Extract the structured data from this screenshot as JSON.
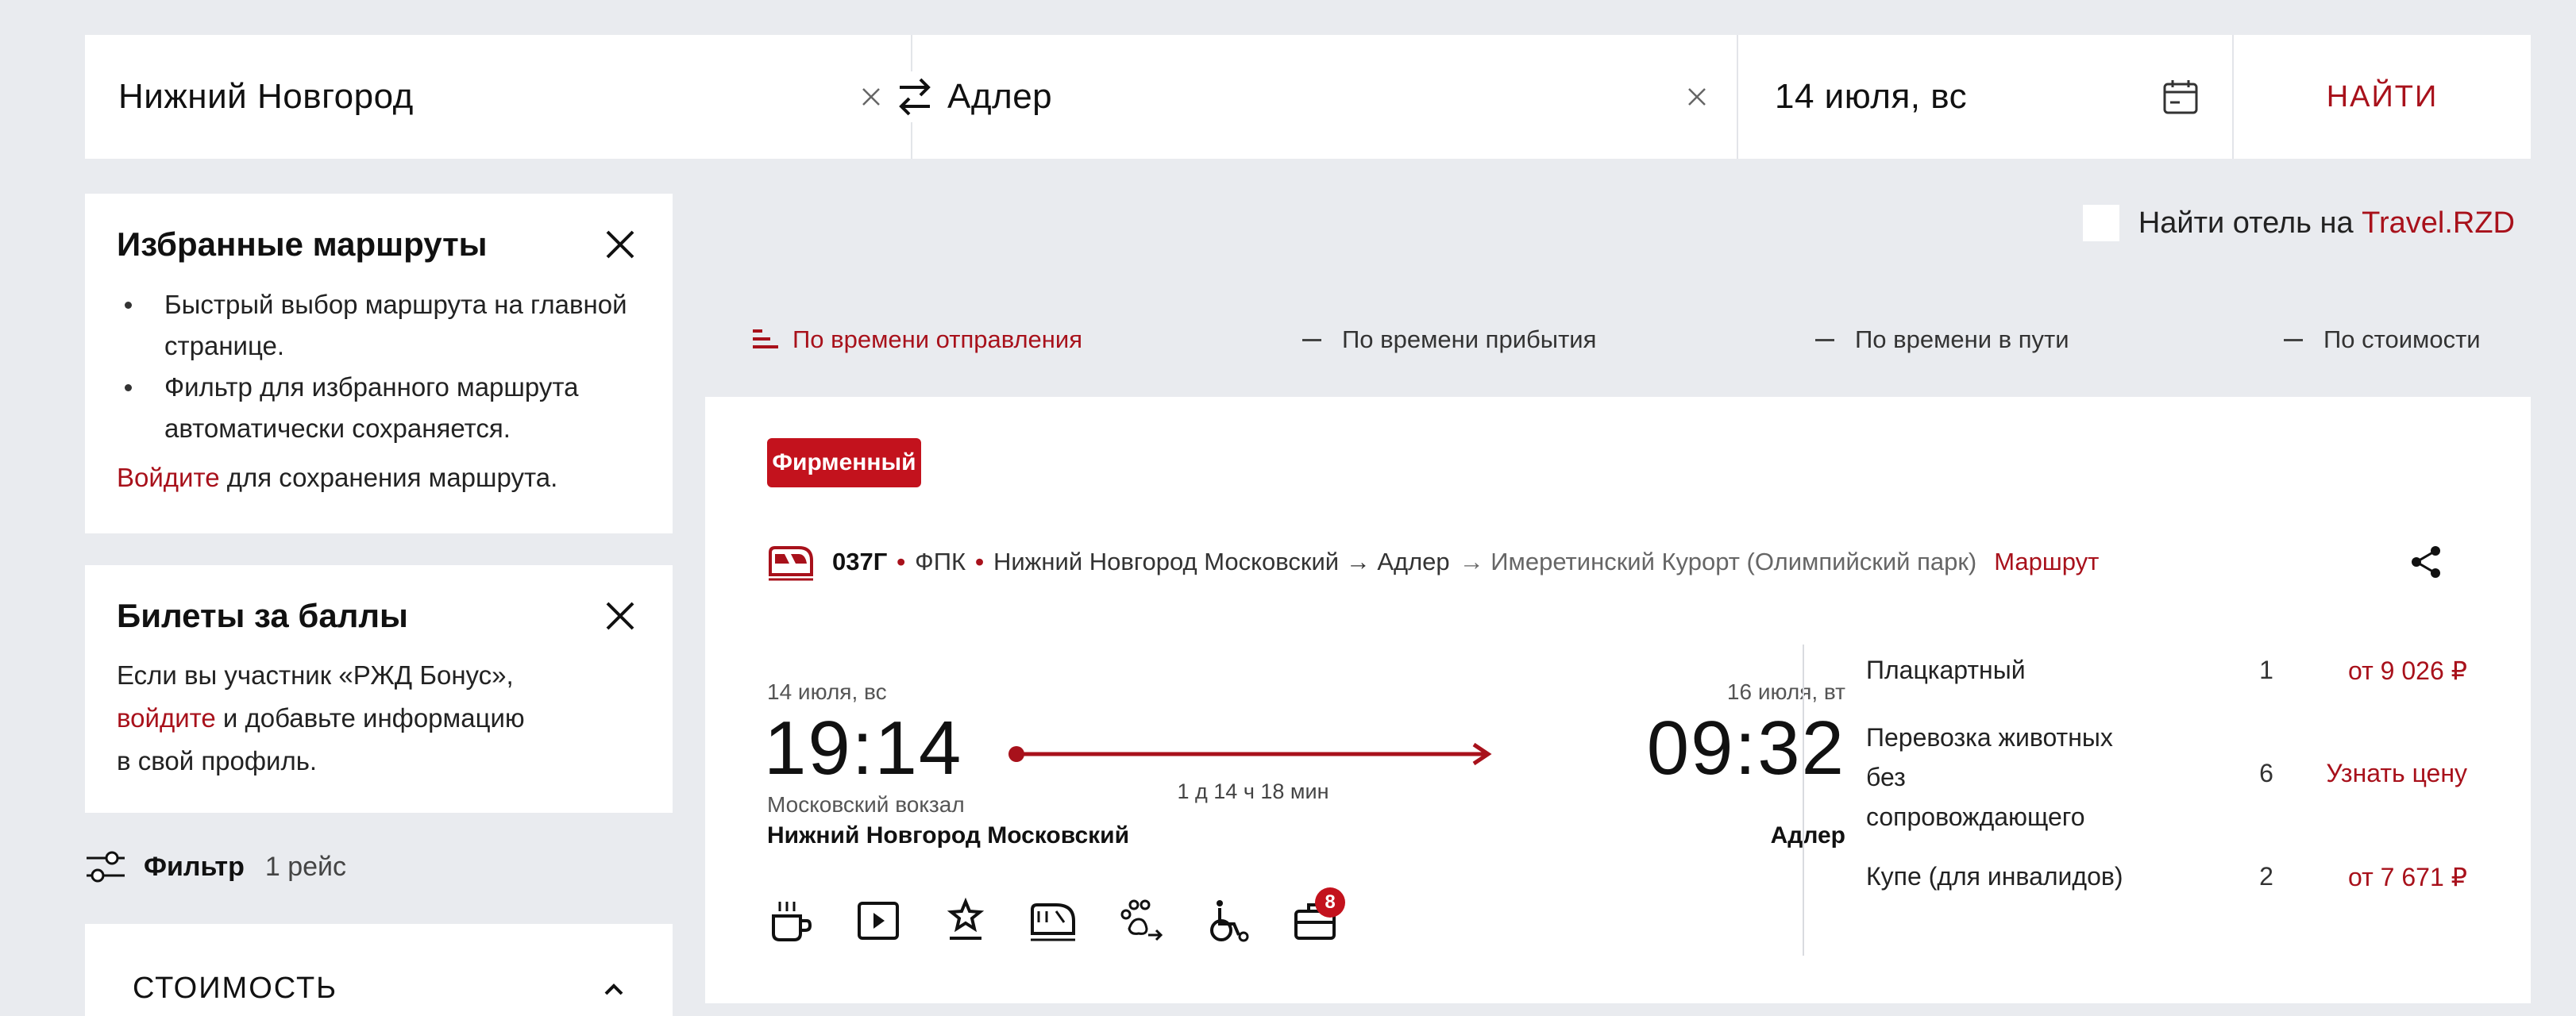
{
  "colors": {
    "accent": "#a8111b",
    "badge": "#c3121d",
    "background": "#e9ebef"
  },
  "search": {
    "from": "Нижний Новгород",
    "to": "Адлер",
    "date": "14 июля, вс",
    "find_label": "НАЙТИ"
  },
  "favorites": {
    "title": "Избранные маршруты",
    "items": [
      "Быстрый выбор маршрута на главной странице.",
      "Фильтр для избранного маршрута автоматически сохраняется."
    ],
    "login_link": "Войдите",
    "login_rest": " для сохранения маршрута."
  },
  "bonus": {
    "title": "Билеты за баллы",
    "text_1": "Если вы участник «РЖД Бонус»,",
    "login_link": "войдите",
    "text_2": " и добавьте информацию",
    "text_3": "в свой профиль."
  },
  "filter": {
    "label": "Фильтр",
    "count": "1 рейс"
  },
  "cost_section": {
    "title": "СТОИМОСТЬ"
  },
  "hotel": {
    "prefix": "Найти отель на ",
    "brand": "Travel.RZD"
  },
  "sort": [
    {
      "label": "По времени отправления",
      "active": true
    },
    {
      "label": "По времени прибытия",
      "active": false
    },
    {
      "label": "По времени в пути",
      "active": false
    },
    {
      "label": "По стоимости",
      "active": false
    }
  ],
  "train": {
    "badge": "Фирменный",
    "number": "037Г",
    "carrier": "ФПК",
    "route_main": "Нижний Новгород Московский → Адлер",
    "route_extra": "→ Имеретинский Курорт (Олимпийский парк)",
    "route_link": "Маршрут",
    "departure": {
      "date": "14 июля, вс",
      "time": "19:14",
      "station_small": "Московский вокзал",
      "station": "Нижний Новгород Московский"
    },
    "arrival": {
      "date": "16 июля, вт",
      "time": "09:32",
      "station": "Адлер"
    },
    "duration": "1 д 14 ч 18 мин",
    "amenities": [
      "coffee-icon",
      "video-icon",
      "award-icon",
      "train-car-icon",
      "pet-icon",
      "wheelchair-icon",
      "luggage-icon"
    ],
    "luggage_badge": "8",
    "fares": [
      {
        "class": "Плацкартный",
        "seats": "1",
        "price": "от 9 026 ₽"
      },
      {
        "class_1": "Перевозка животных",
        "class_2": "без",
        "class_3": "сопровождающего",
        "seats": "6",
        "price": "Узнать цену"
      },
      {
        "class": "Купе (для инвалидов)",
        "seats": "2",
        "price": "от 7 671 ₽"
      }
    ]
  }
}
